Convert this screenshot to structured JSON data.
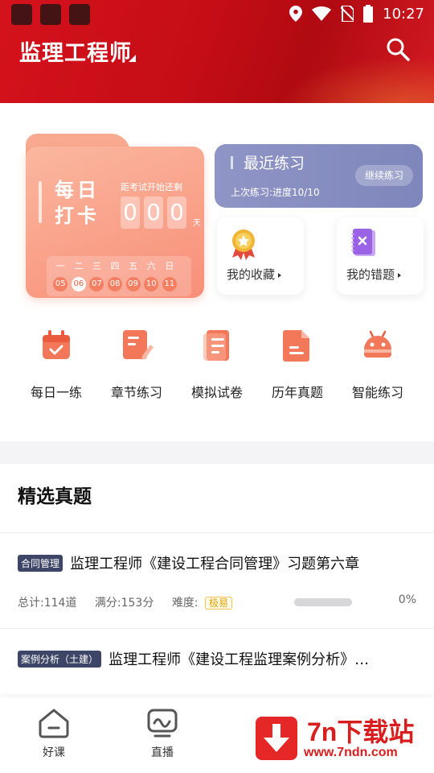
{
  "status_bar": {
    "time": "10:27"
  },
  "header": {
    "title": "监理工程师"
  },
  "checkin": {
    "title": "每日打卡",
    "countdown_label": "距考试开始还剩",
    "digits": [
      "0",
      "0",
      "0"
    ],
    "unit": "天",
    "weekdays": [
      "一",
      "二",
      "三",
      "四",
      "五",
      "六",
      "日"
    ],
    "dates": [
      "05",
      "06",
      "07",
      "08",
      "09",
      "10",
      "11"
    ],
    "today": "06"
  },
  "recent_practice": {
    "title": "最近练习",
    "progress_text": "上次练习:进度10/10",
    "button": "继续练习"
  },
  "my_favorites": {
    "label": "我的收藏"
  },
  "my_mistakes": {
    "label": "我的错题"
  },
  "quick_menu": [
    {
      "label": "每日一练",
      "icon": "calendar-check-icon"
    },
    {
      "label": "章节练习",
      "icon": "note-edit-icon"
    },
    {
      "label": "模拟试卷",
      "icon": "paper-list-icon"
    },
    {
      "label": "历年真题",
      "icon": "document-icon"
    },
    {
      "label": "智能练习",
      "icon": "android-robot-icon"
    }
  ],
  "featured": {
    "title": "精选真题",
    "items": [
      {
        "tag": "合同管理",
        "title": "监理工程师《建设工程合同管理》习题第六章",
        "total": "总计:114道",
        "full_score": "满分:153分",
        "difficulty_label": "难度:",
        "difficulty": "极易",
        "progress": 0,
        "progress_text": "0%"
      },
      {
        "tag": "案例分析（土建）",
        "title": "监理工程师《建设工程监理案例分析》…"
      }
    ]
  },
  "bottom_nav": [
    {
      "label": "好课",
      "icon": "home-course-icon"
    },
    {
      "label": "直播",
      "icon": "live-tv-icon"
    }
  ],
  "watermark": {
    "brand": "7n下载站",
    "url": "www.7ndn.com"
  },
  "colors": {
    "brand_red": "#d4121c",
    "recent_card": "#8f95c5",
    "checkin_card": "#f88f78"
  }
}
